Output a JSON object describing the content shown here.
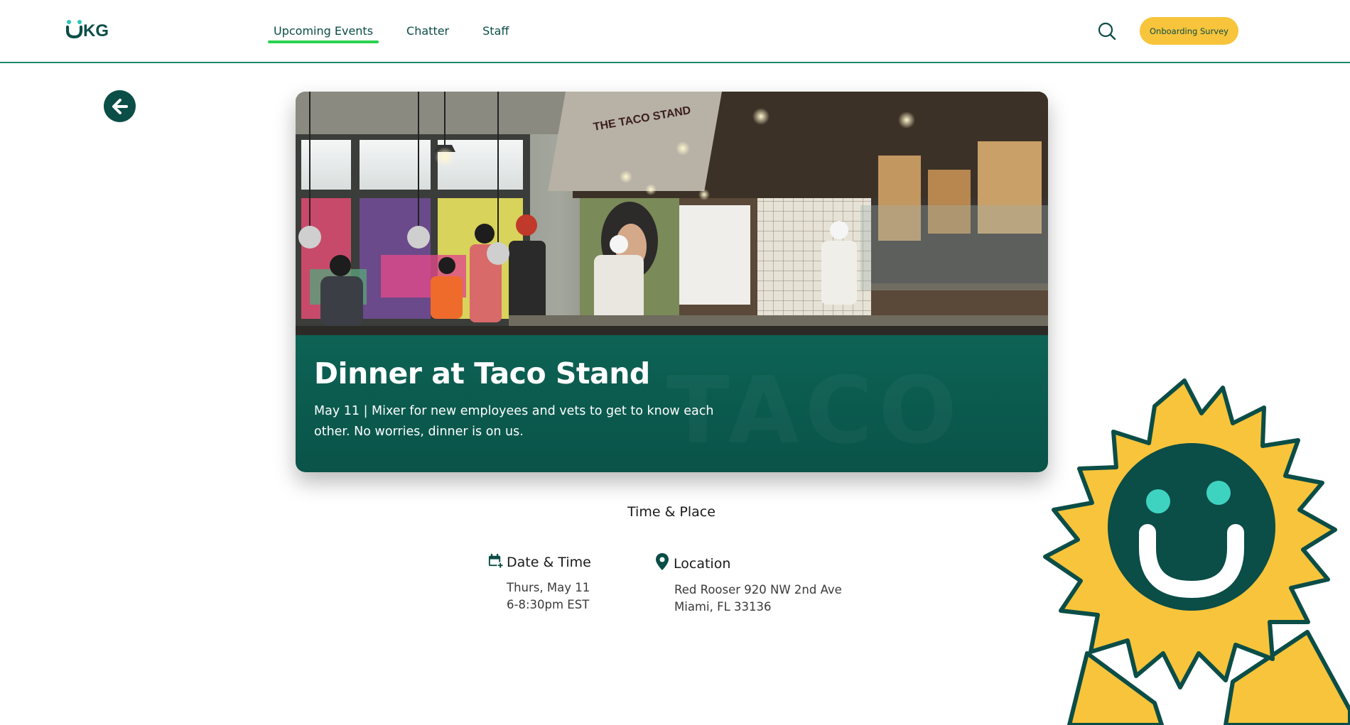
{
  "header": {
    "logo_text": "UKG",
    "nav": [
      {
        "label": "Upcoming Events",
        "active": true
      },
      {
        "label": "Chatter",
        "active": false
      },
      {
        "label": "Staff",
        "active": false
      }
    ],
    "survey_button": "Onboarding Survey"
  },
  "event": {
    "title": "Dinner at Taco Stand",
    "description": "May 11 | Mixer for new employees and vets to get to know each other. No worries, dinner is on us.",
    "photo_sign_text": "THE TACO STAND"
  },
  "time_place": {
    "heading": "Time & Place",
    "date_time": {
      "label": "Date & Time",
      "line1": "Thurs, May 11",
      "line2": "6-8:30pm EST"
    },
    "location": {
      "label": "Location",
      "line1": "Red Rooser 920 NW 2nd Ave",
      "line2": "Miami, FL 33136"
    }
  },
  "colors": {
    "brand_dark": "#0b4d47",
    "accent_green": "#2ad24f",
    "survey_yellow": "#f7c43b",
    "band_teal": "#0b5a4e",
    "badge_yellow": "#f7c43b",
    "badge_eyes": "#3ed3c1"
  }
}
